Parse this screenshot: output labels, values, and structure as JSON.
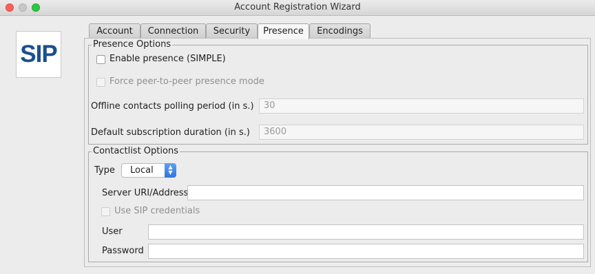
{
  "window": {
    "title": "Account Registration Wizard"
  },
  "logo": {
    "text": "SIP"
  },
  "tabs": [
    {
      "label": "Account",
      "active": false
    },
    {
      "label": "Connection",
      "active": false
    },
    {
      "label": "Security",
      "active": false
    },
    {
      "label": "Presence",
      "active": true
    },
    {
      "label": "Encodings",
      "active": false
    }
  ],
  "presence": {
    "legend": "Presence Options",
    "enable_label": "Enable presence (SIMPLE)",
    "enable_checked": false,
    "p2p_label": "Force peer-to-peer presence mode",
    "p2p_enabled": false,
    "polling_label": "Offline contacts polling period (in s.)",
    "polling_value": "30",
    "subscription_label": "Default subscription duration (in s.)",
    "subscription_value": "3600"
  },
  "contactlist": {
    "legend": "Contactlist Options",
    "type_label": "Type",
    "type_value": "Local",
    "server_label": "Server URI/Address",
    "server_value": "",
    "credentials_label": "Use SIP credentials",
    "user_label": "User",
    "user_value": "",
    "password_label": "Password",
    "password_value": ""
  },
  "colors": {
    "select_accent": "#2f74e0",
    "logo_text": "#1b4f8f"
  }
}
